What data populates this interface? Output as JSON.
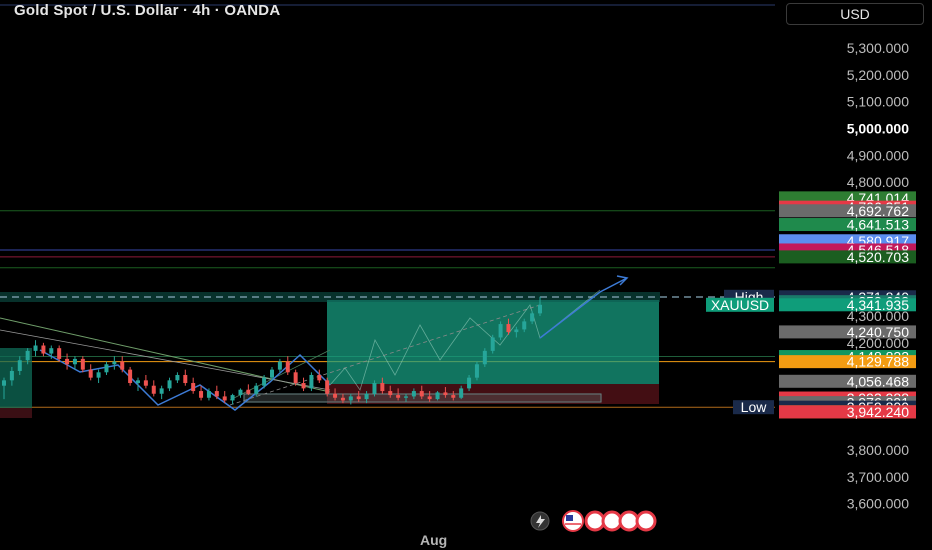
{
  "chart_data": {
    "type": "candlestick",
    "title": "Gold Spot / U.S. Dollar · 4h · OANDA",
    "currency": "USD",
    "symbol": "XAUUSD",
    "ylim": [
      3550,
      5360
    ],
    "y_ticks": [
      {
        "value": 5300,
        "label": "5,300.000"
      },
      {
        "value": 5200,
        "label": "5,200.000"
      },
      {
        "value": 5100,
        "label": "5,100.000"
      },
      {
        "value": 5000,
        "label": "5,000.000",
        "bold": true
      },
      {
        "value": 4900,
        "label": "4,900.000"
      },
      {
        "value": 4800,
        "label": "4,800.000"
      },
      {
        "value": 4300,
        "label": "4,300.000"
      },
      {
        "value": 4200,
        "label": "4,200.000"
      },
      {
        "value": 3800,
        "label": "3,800.000"
      },
      {
        "value": 3700,
        "label": "3,700.000"
      },
      {
        "value": 3600,
        "label": "3,600.000"
      }
    ],
    "x_labels": [
      {
        "label": "Aug"
      }
    ],
    "price_tags": [
      {
        "value": 4741.014,
        "label": "4,741.014",
        "color": "#2e7d32"
      },
      {
        "value": 4706.351,
        "label": "4,706.351",
        "color": "#e53946"
      },
      {
        "value": 4692.762,
        "label": "4,692.762",
        "color": "#6b6b6b"
      },
      {
        "value": 4641.513,
        "label": "4,641.513",
        "color": "#1f8a4c"
      },
      {
        "value": 4580.917,
        "label": "4,580.917",
        "color": "#5b8def"
      },
      {
        "value": 4546.518,
        "label": "4,546.518",
        "color": "#c2185b"
      },
      {
        "value": 4520.703,
        "label": "4,520.703",
        "color": "#1b5e20"
      },
      {
        "value": 4371.84,
        "label": "4,371.840",
        "color": "#1a2a4a",
        "tag": "High"
      },
      {
        "value": 4353.633,
        "label": "4,353.633",
        "color": "#1a7a6a"
      },
      {
        "value": 4341.935,
        "label": "4,341.935",
        "color": "#0f9d7a",
        "tag": "XAUUSD"
      },
      {
        "value": 4240.75,
        "label": "4,240.750",
        "color": "#6b6b6b"
      },
      {
        "value": 4148.822,
        "label": "4,148.822",
        "color": "#12965f"
      },
      {
        "value": 4129.788,
        "label": "4,129.788",
        "color": "#f39c12"
      },
      {
        "value": 4056.468,
        "label": "4,056.468",
        "color": "#6b6b6b"
      },
      {
        "value": 3993.988,
        "label": "3,993.988",
        "color": "#e53946"
      },
      {
        "value": 3976.891,
        "label": "3,976.891",
        "color": "#6b6b6b"
      },
      {
        "value": 3959.8,
        "label": "3,959.800",
        "color": "#1a2a4a",
        "tag": "Low"
      },
      {
        "value": 3942.577,
        "label": "3,942.577",
        "color": "#f39c12"
      },
      {
        "value": 3942.24,
        "label": "3,942.240",
        "color": "#e53946"
      }
    ],
    "horizontal_lines": [
      {
        "value": 4692.762,
        "color": "#1b5e20"
      },
      {
        "value": 4546.518,
        "color": "#3949ab"
      },
      {
        "value": 4520.703,
        "color": "#8e1b3a"
      },
      {
        "value": 4480,
        "color": "#1b5e20"
      },
      {
        "value": 4148.822,
        "color": "#1f5e3a"
      },
      {
        "value": 4129.788,
        "color": "#f39c12"
      },
      {
        "value": 3959.8,
        "color": "#b06a1a"
      }
    ],
    "candles": [
      {
        "o": 4040,
        "h": 4070,
        "l": 3990,
        "c": 4060
      },
      {
        "o": 4060,
        "h": 4110,
        "l": 4040,
        "c": 4095
      },
      {
        "o": 4095,
        "h": 4150,
        "l": 4080,
        "c": 4135
      },
      {
        "o": 4135,
        "h": 4180,
        "l": 4120,
        "c": 4170
      },
      {
        "o": 4170,
        "h": 4210,
        "l": 4150,
        "c": 4190
      },
      {
        "o": 4190,
        "h": 4200,
        "l": 4150,
        "c": 4160
      },
      {
        "o": 4160,
        "h": 4190,
        "l": 4140,
        "c": 4180
      },
      {
        "o": 4180,
        "h": 4190,
        "l": 4130,
        "c": 4140
      },
      {
        "o": 4140,
        "h": 4160,
        "l": 4100,
        "c": 4120
      },
      {
        "o": 4120,
        "h": 4150,
        "l": 4100,
        "c": 4140
      },
      {
        "o": 4140,
        "h": 4150,
        "l": 4090,
        "c": 4100
      },
      {
        "o": 4100,
        "h": 4120,
        "l": 4060,
        "c": 4070
      },
      {
        "o": 4070,
        "h": 4100,
        "l": 4050,
        "c": 4090
      },
      {
        "o": 4090,
        "h": 4130,
        "l": 4080,
        "c": 4120
      },
      {
        "o": 4120,
        "h": 4150,
        "l": 4100,
        "c": 4130
      },
      {
        "o": 4130,
        "h": 4150,
        "l": 4090,
        "c": 4100
      },
      {
        "o": 4100,
        "h": 4110,
        "l": 4040,
        "c": 4050
      },
      {
        "o": 4050,
        "h": 4070,
        "l": 4020,
        "c": 4060
      },
      {
        "o": 4060,
        "h": 4080,
        "l": 4030,
        "c": 4040
      },
      {
        "o": 4040,
        "h": 4060,
        "l": 4000,
        "c": 4010
      },
      {
        "o": 4010,
        "h": 4040,
        "l": 3990,
        "c": 4030
      },
      {
        "o": 4030,
        "h": 4070,
        "l": 4020,
        "c": 4060
      },
      {
        "o": 4060,
        "h": 4090,
        "l": 4050,
        "c": 4080
      },
      {
        "o": 4080,
        "h": 4100,
        "l": 4040,
        "c": 4050
      },
      {
        "o": 4050,
        "h": 4070,
        "l": 4010,
        "c": 4020
      },
      {
        "o": 4020,
        "h": 4040,
        "l": 3985,
        "c": 3995
      },
      {
        "o": 3995,
        "h": 4030,
        "l": 3985,
        "c": 4020
      },
      {
        "o": 4020,
        "h": 4040,
        "l": 3990,
        "c": 4000
      },
      {
        "o": 4000,
        "h": 4020,
        "l": 3975,
        "c": 3985
      },
      {
        "o": 3985,
        "h": 4010,
        "l": 3970,
        "c": 4005
      },
      {
        "o": 4005,
        "h": 4030,
        "l": 3995,
        "c": 4025
      },
      {
        "o": 4025,
        "h": 4045,
        "l": 4005,
        "c": 4010
      },
      {
        "o": 4010,
        "h": 4050,
        "l": 4000,
        "c": 4040
      },
      {
        "o": 4040,
        "h": 4080,
        "l": 4030,
        "c": 4070
      },
      {
        "o": 4070,
        "h": 4110,
        "l": 4060,
        "c": 4100
      },
      {
        "o": 4100,
        "h": 4140,
        "l": 4090,
        "c": 4130
      },
      {
        "o": 4130,
        "h": 4150,
        "l": 4080,
        "c": 4090
      },
      {
        "o": 4090,
        "h": 4100,
        "l": 4040,
        "c": 4050
      },
      {
        "o": 4050,
        "h": 4070,
        "l": 4020,
        "c": 4030
      },
      {
        "o": 4030,
        "h": 4090,
        "l": 4020,
        "c": 4080
      },
      {
        "o": 4080,
        "h": 4100,
        "l": 4050,
        "c": 4060
      },
      {
        "o": 4060,
        "h": 4070,
        "l": 4000,
        "c": 4010
      },
      {
        "o": 4010,
        "h": 4030,
        "l": 3985,
        "c": 3995
      },
      {
        "o": 3995,
        "h": 4010,
        "l": 3975,
        "c": 3985
      },
      {
        "o": 3985,
        "h": 4010,
        "l": 3970,
        "c": 4000
      },
      {
        "o": 4000,
        "h": 4020,
        "l": 3980,
        "c": 3990
      },
      {
        "o": 3990,
        "h": 4020,
        "l": 3975,
        "c": 4010
      },
      {
        "o": 4010,
        "h": 4060,
        "l": 4000,
        "c": 4050
      },
      {
        "o": 4050,
        "h": 4070,
        "l": 4010,
        "c": 4020
      },
      {
        "o": 4020,
        "h": 4040,
        "l": 3995,
        "c": 4005
      },
      {
        "o": 4005,
        "h": 4030,
        "l": 3985,
        "c": 3995
      },
      {
        "o": 3995,
        "h": 4010,
        "l": 3980,
        "c": 4000
      },
      {
        "o": 4000,
        "h": 4030,
        "l": 3990,
        "c": 4020
      },
      {
        "o": 4020,
        "h": 4040,
        "l": 3990,
        "c": 4000
      },
      {
        "o": 4000,
        "h": 4020,
        "l": 3980,
        "c": 3990
      },
      {
        "o": 3990,
        "h": 4020,
        "l": 3985,
        "c": 4015
      },
      {
        "o": 4015,
        "h": 4035,
        "l": 3995,
        "c": 4005
      },
      {
        "o": 4005,
        "h": 4020,
        "l": 3985,
        "c": 3995
      },
      {
        "o": 3995,
        "h": 4040,
        "l": 3990,
        "c": 4030
      },
      {
        "o": 4030,
        "h": 4080,
        "l": 4020,
        "c": 4070
      },
      {
        "o": 4070,
        "h": 4130,
        "l": 4060,
        "c": 4120
      },
      {
        "o": 4120,
        "h": 4180,
        "l": 4110,
        "c": 4170
      },
      {
        "o": 4170,
        "h": 4230,
        "l": 4160,
        "c": 4220
      },
      {
        "o": 4220,
        "h": 4280,
        "l": 4210,
        "c": 4270
      },
      {
        "o": 4270,
        "h": 4290,
        "l": 4230,
        "c": 4240
      },
      {
        "o": 4240,
        "h": 4260,
        "l": 4220,
        "c": 4250
      },
      {
        "o": 4250,
        "h": 4290,
        "l": 4240,
        "c": 4280
      },
      {
        "o": 4280,
        "h": 4320,
        "l": 4270,
        "c": 4310
      },
      {
        "o": 4310,
        "h": 4372,
        "l": 4300,
        "c": 4342
      }
    ]
  }
}
